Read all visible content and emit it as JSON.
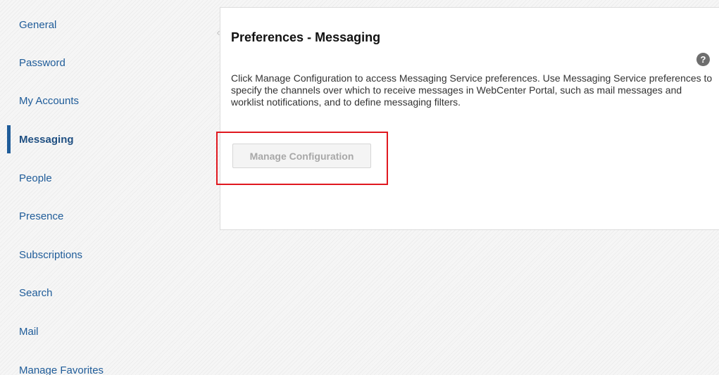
{
  "sidebar": {
    "items": [
      {
        "label": "General"
      },
      {
        "label": "Password"
      },
      {
        "label": "My Accounts"
      },
      {
        "label": "Messaging"
      },
      {
        "label": "People"
      },
      {
        "label": "Presence"
      },
      {
        "label": "Subscriptions"
      },
      {
        "label": "Search"
      },
      {
        "label": "Mail"
      },
      {
        "label": "Manage Favorites"
      }
    ],
    "active": "Messaging"
  },
  "panel": {
    "title": "Preferences - Messaging",
    "help_icon": "?",
    "description": "Click Manage Configuration to access Messaging Service preferences. Use Messaging Service preferences to specify the channels over which to receive messages in WebCenter Portal, such as mail messages and worklist notifications, and to define messaging filters.",
    "manage_button": "Manage Configuration",
    "collapse_glyph": "‹"
  },
  "colors": {
    "link": "#1f5c99",
    "highlight": "#e0181f"
  }
}
